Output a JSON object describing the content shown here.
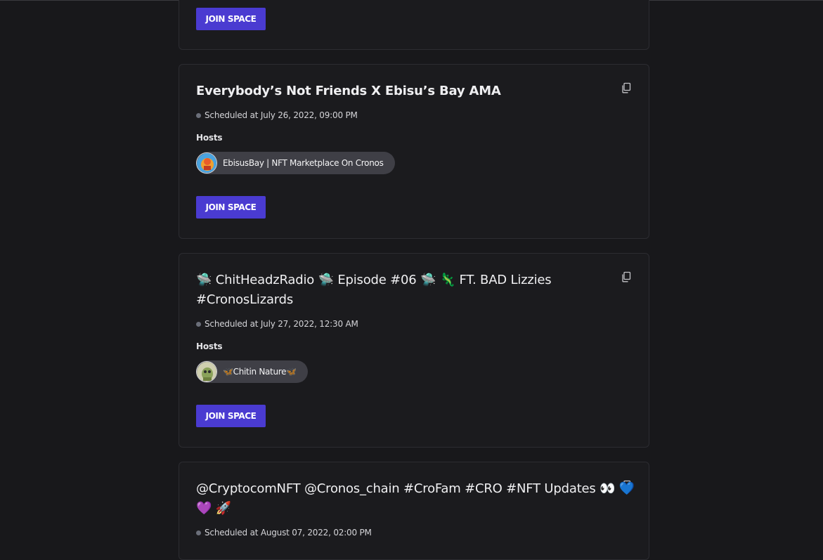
{
  "spaces": [
    {
      "join_label": "JOIN SPACE"
    },
    {
      "title": "Everybody’s Not Friends X Ebisu’s Bay AMA",
      "scheduled": "Scheduled at July 26, 2022, 09:00 PM",
      "hosts_label": "Hosts",
      "host_name": "EbisusBay | NFT Marketplace On Cronos",
      "join_label": "JOIN SPACE"
    },
    {
      "title_line1": "🛸 ChitHeadzRadio 🛸 Episode #06 🛸 🦎 FT. BAD Lizzies",
      "title_line2": "#CronosLizards",
      "scheduled": "Scheduled at July 27, 2022, 12:30 AM",
      "hosts_label": "Hosts",
      "host_name": "🦋Chitin Nature🦋",
      "join_label": "JOIN SPACE"
    },
    {
      "title_line1": "@CryptocomNFT @Cronos_chain #CroFam #CRO #NFT Updates 👀 💙",
      "title_line2": "💜 🚀",
      "scheduled": "Scheduled at August 07, 2022, 02:00 PM"
    }
  ],
  "colors": {
    "background": "#18181b",
    "card_border": "#2c2c31",
    "join_button": "#4a3bd1",
    "host_chip": "#3f3f46"
  },
  "icons": {
    "copy": "copy-icon",
    "status_dot": "status-dot-icon"
  }
}
